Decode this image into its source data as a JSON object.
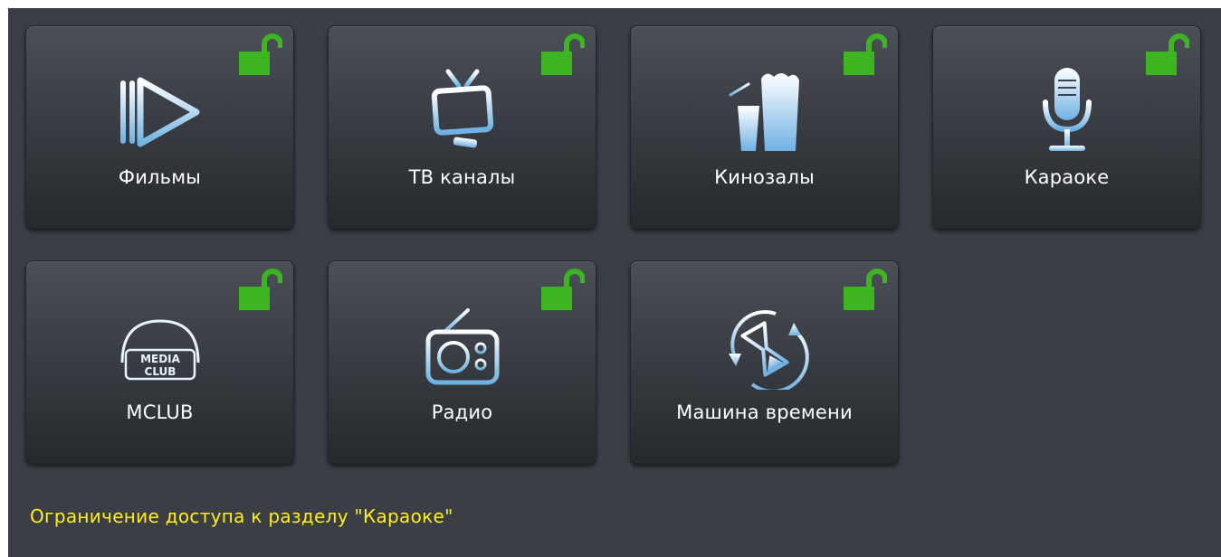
{
  "tiles": [
    {
      "label": "Фильмы",
      "icon": "film-play-icon",
      "locked": false
    },
    {
      "label": "ТВ каналы",
      "icon": "tv-icon",
      "locked": false
    },
    {
      "label": "Кинозалы",
      "icon": "popcorn-drink-icon",
      "locked": false
    },
    {
      "label": "Караоке",
      "icon": "microphone-icon",
      "locked": false
    },
    {
      "label": "MCLUB",
      "icon": "media-club-logo",
      "logo_text": "MEDIA CLUB",
      "locked": false
    },
    {
      "label": "Радио",
      "icon": "radio-icon",
      "locked": false
    },
    {
      "label": "Машина времени",
      "icon": "time-machine-icon",
      "locked": false
    }
  ],
  "status": {
    "message": "Ограничение доступа к разделу \"Караоке\""
  },
  "colors": {
    "background": "#3b3e44",
    "lock": "#3cb521",
    "icon": "#a8d4f2",
    "status_text": "#ffef1a",
    "label_text": "#ffffff"
  }
}
